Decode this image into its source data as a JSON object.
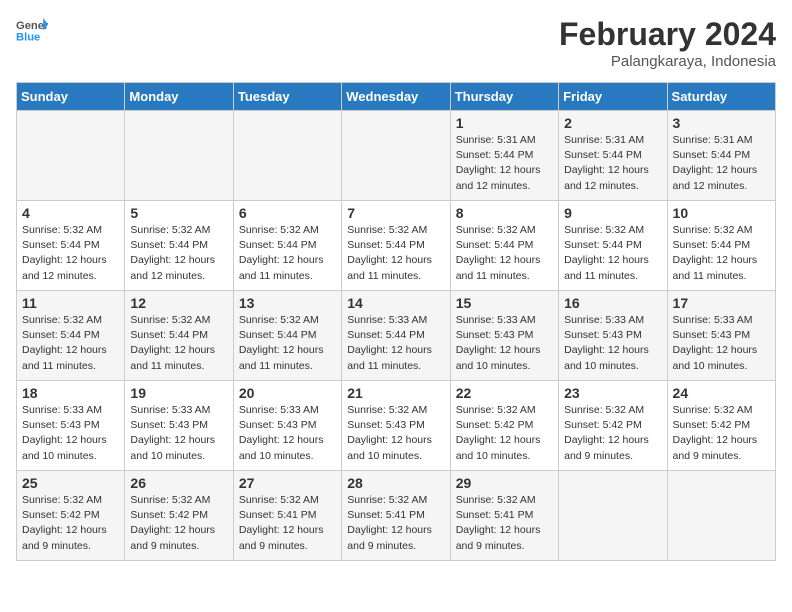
{
  "header": {
    "logo_general": "General",
    "logo_blue": "Blue",
    "title": "February 2024",
    "subtitle": "Palangkaraya, Indonesia"
  },
  "days_of_week": [
    "Sunday",
    "Monday",
    "Tuesday",
    "Wednesday",
    "Thursday",
    "Friday",
    "Saturday"
  ],
  "weeks": [
    [
      {
        "day": "",
        "detail": ""
      },
      {
        "day": "",
        "detail": ""
      },
      {
        "day": "",
        "detail": ""
      },
      {
        "day": "",
        "detail": ""
      },
      {
        "day": "1",
        "detail": "Sunrise: 5:31 AM\nSunset: 5:44 PM\nDaylight: 12 hours\nand 12 minutes."
      },
      {
        "day": "2",
        "detail": "Sunrise: 5:31 AM\nSunset: 5:44 PM\nDaylight: 12 hours\nand 12 minutes."
      },
      {
        "day": "3",
        "detail": "Sunrise: 5:31 AM\nSunset: 5:44 PM\nDaylight: 12 hours\nand 12 minutes."
      }
    ],
    [
      {
        "day": "4",
        "detail": "Sunrise: 5:32 AM\nSunset: 5:44 PM\nDaylight: 12 hours\nand 12 minutes."
      },
      {
        "day": "5",
        "detail": "Sunrise: 5:32 AM\nSunset: 5:44 PM\nDaylight: 12 hours\nand 12 minutes."
      },
      {
        "day": "6",
        "detail": "Sunrise: 5:32 AM\nSunset: 5:44 PM\nDaylight: 12 hours\nand 11 minutes."
      },
      {
        "day": "7",
        "detail": "Sunrise: 5:32 AM\nSunset: 5:44 PM\nDaylight: 12 hours\nand 11 minutes."
      },
      {
        "day": "8",
        "detail": "Sunrise: 5:32 AM\nSunset: 5:44 PM\nDaylight: 12 hours\nand 11 minutes."
      },
      {
        "day": "9",
        "detail": "Sunrise: 5:32 AM\nSunset: 5:44 PM\nDaylight: 12 hours\nand 11 minutes."
      },
      {
        "day": "10",
        "detail": "Sunrise: 5:32 AM\nSunset: 5:44 PM\nDaylight: 12 hours\nand 11 minutes."
      }
    ],
    [
      {
        "day": "11",
        "detail": "Sunrise: 5:32 AM\nSunset: 5:44 PM\nDaylight: 12 hours\nand 11 minutes."
      },
      {
        "day": "12",
        "detail": "Sunrise: 5:32 AM\nSunset: 5:44 PM\nDaylight: 12 hours\nand 11 minutes."
      },
      {
        "day": "13",
        "detail": "Sunrise: 5:32 AM\nSunset: 5:44 PM\nDaylight: 12 hours\nand 11 minutes."
      },
      {
        "day": "14",
        "detail": "Sunrise: 5:33 AM\nSunset: 5:44 PM\nDaylight: 12 hours\nand 11 minutes."
      },
      {
        "day": "15",
        "detail": "Sunrise: 5:33 AM\nSunset: 5:43 PM\nDaylight: 12 hours\nand 10 minutes."
      },
      {
        "day": "16",
        "detail": "Sunrise: 5:33 AM\nSunset: 5:43 PM\nDaylight: 12 hours\nand 10 minutes."
      },
      {
        "day": "17",
        "detail": "Sunrise: 5:33 AM\nSunset: 5:43 PM\nDaylight: 12 hours\nand 10 minutes."
      }
    ],
    [
      {
        "day": "18",
        "detail": "Sunrise: 5:33 AM\nSunset: 5:43 PM\nDaylight: 12 hours\nand 10 minutes."
      },
      {
        "day": "19",
        "detail": "Sunrise: 5:33 AM\nSunset: 5:43 PM\nDaylight: 12 hours\nand 10 minutes."
      },
      {
        "day": "20",
        "detail": "Sunrise: 5:33 AM\nSunset: 5:43 PM\nDaylight: 12 hours\nand 10 minutes."
      },
      {
        "day": "21",
        "detail": "Sunrise: 5:32 AM\nSunset: 5:43 PM\nDaylight: 12 hours\nand 10 minutes."
      },
      {
        "day": "22",
        "detail": "Sunrise: 5:32 AM\nSunset: 5:42 PM\nDaylight: 12 hours\nand 10 minutes."
      },
      {
        "day": "23",
        "detail": "Sunrise: 5:32 AM\nSunset: 5:42 PM\nDaylight: 12 hours\nand 9 minutes."
      },
      {
        "day": "24",
        "detail": "Sunrise: 5:32 AM\nSunset: 5:42 PM\nDaylight: 12 hours\nand 9 minutes."
      }
    ],
    [
      {
        "day": "25",
        "detail": "Sunrise: 5:32 AM\nSunset: 5:42 PM\nDaylight: 12 hours\nand 9 minutes."
      },
      {
        "day": "26",
        "detail": "Sunrise: 5:32 AM\nSunset: 5:42 PM\nDaylight: 12 hours\nand 9 minutes."
      },
      {
        "day": "27",
        "detail": "Sunrise: 5:32 AM\nSunset: 5:41 PM\nDaylight: 12 hours\nand 9 minutes."
      },
      {
        "day": "28",
        "detail": "Sunrise: 5:32 AM\nSunset: 5:41 PM\nDaylight: 12 hours\nand 9 minutes."
      },
      {
        "day": "29",
        "detail": "Sunrise: 5:32 AM\nSunset: 5:41 PM\nDaylight: 12 hours\nand 9 minutes."
      },
      {
        "day": "",
        "detail": ""
      },
      {
        "day": "",
        "detail": ""
      }
    ]
  ]
}
